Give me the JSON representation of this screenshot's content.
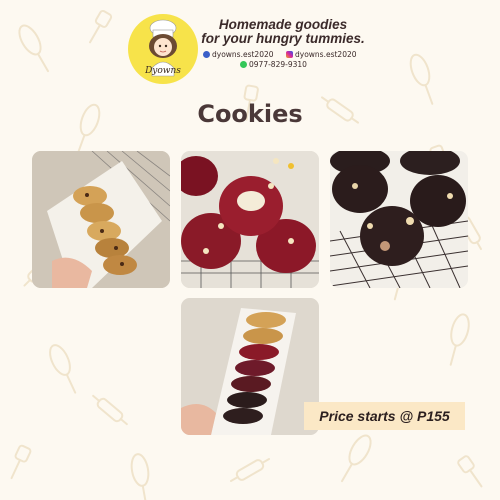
{
  "brand": {
    "logo_text": "Dyowns",
    "tagline_line1": "Homemade goodies",
    "tagline_line2": "for your hungry tummies.",
    "facebook": "dyowns.est2020",
    "instagram": "dyowns.est2020",
    "whatsapp": "0977-829-9310"
  },
  "section": {
    "title": "Cookies"
  },
  "promo": {
    "price_text": "Price starts @ P155"
  },
  "photos": [
    {
      "subject": "chocolate chip cookies in box"
    },
    {
      "subject": "red velvet cookies"
    },
    {
      "subject": "double chocolate cookies"
    },
    {
      "subject": "assorted cookies in box"
    }
  ],
  "colors": {
    "logo_yellow": "#f7e34a",
    "background": "#fdf9f1",
    "price_bg": "#fbe8c6",
    "title": "#4a3838"
  }
}
